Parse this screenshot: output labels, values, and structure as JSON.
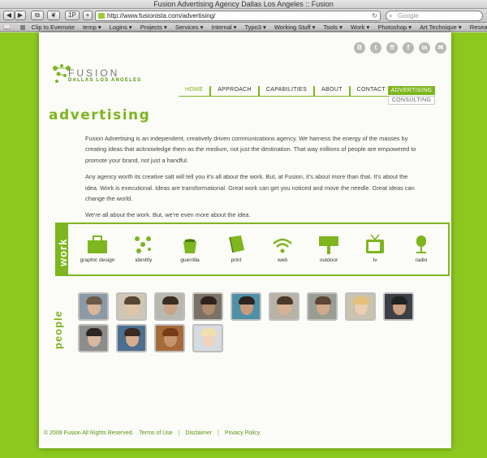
{
  "window": {
    "title": "Fusion Advertising Agency Dallas Los Angeles :: Fusion"
  },
  "toolbar": {
    "url": "http://www.fusionista.com/advertising/",
    "search_placeholder": "Google",
    "onep_label": "1P",
    "plus_label": "+"
  },
  "bookmarks": [
    "Clip to Evernote",
    "temp ▾",
    "Logins ▾",
    "Projects ▾",
    "Services ▾",
    "Internal ▾",
    "Typo3 ▾",
    "Working Stuff ▾",
    "Tools ▾",
    "Work ▾",
    "Photoshop ▾",
    "Art Technique ▾",
    "Research ▾"
  ],
  "social": [
    "B",
    "t",
    "ff",
    "f",
    "in",
    "✉"
  ],
  "logo": {
    "name": "FUSION",
    "sub": "DALLAS  LOS ANGELES"
  },
  "nav": {
    "items": [
      "HOME",
      "APPROACH",
      "CAPABILITIES",
      "ABOUT",
      "CONTACT"
    ],
    "selected": "ADVERTISING",
    "sub": "CONSULTING"
  },
  "heading": "advertising",
  "paragraphs": [
    "Fusion Advertising is an independent, creatively driven communications agency. We harness the energy of the masses by creating ideas that acknowledge them as the medium, not just the destination. That way millions of people are empowered to promote your brand, not just a handful.",
    "Any agency worth its creative salt will tell you it's all about the work. But, at Fusion, it's about more than that. It's about the idea. Work is executional. Ideas are transformational. Great work can get you noticed and move the needle. Great ideas can change the world.",
    "We're all about the work. But, we're even more about the idea."
  ],
  "work": {
    "label": "work",
    "items": [
      "graphic design",
      "identity",
      "guerrilla",
      "print",
      "web",
      "outdoor",
      "tv",
      "radio"
    ]
  },
  "people": {
    "label": "people",
    "count": 13
  },
  "footer": {
    "copyright": "© 2009 Fusion All Rights Reserved.",
    "terms": "Terms of Use",
    "disclaimer": "Disclaimer",
    "privacy": "Privacy Policy"
  },
  "colors": {
    "accent": "#7db61e",
    "background": "#8cc81e"
  }
}
